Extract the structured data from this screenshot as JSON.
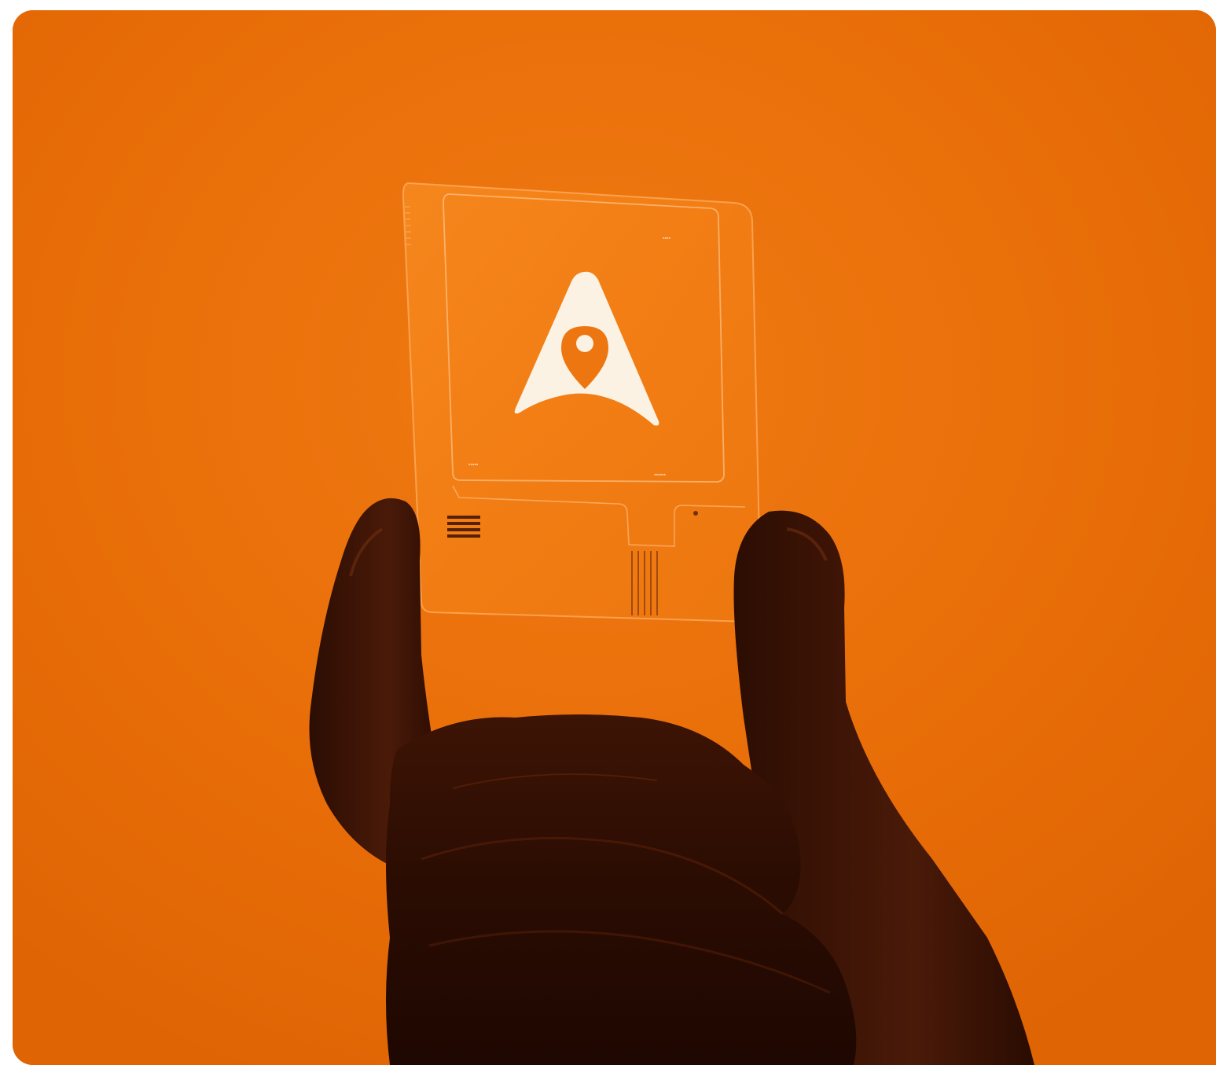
{
  "image": {
    "description_label": "Photo",
    "colors": {
      "background": "#e56a06",
      "background_highlight": "#f07a12",
      "card_glass": "#f5861f",
      "card_edge": "#ffb26a",
      "logo": "#fbf2e4",
      "hand_dark": "#2a0c02",
      "hand_mid": "#4a1706",
      "frame": "#ffffff"
    },
    "icons": [
      "location-pin-mountain-logo-icon",
      "contact-pads-icon"
    ]
  }
}
